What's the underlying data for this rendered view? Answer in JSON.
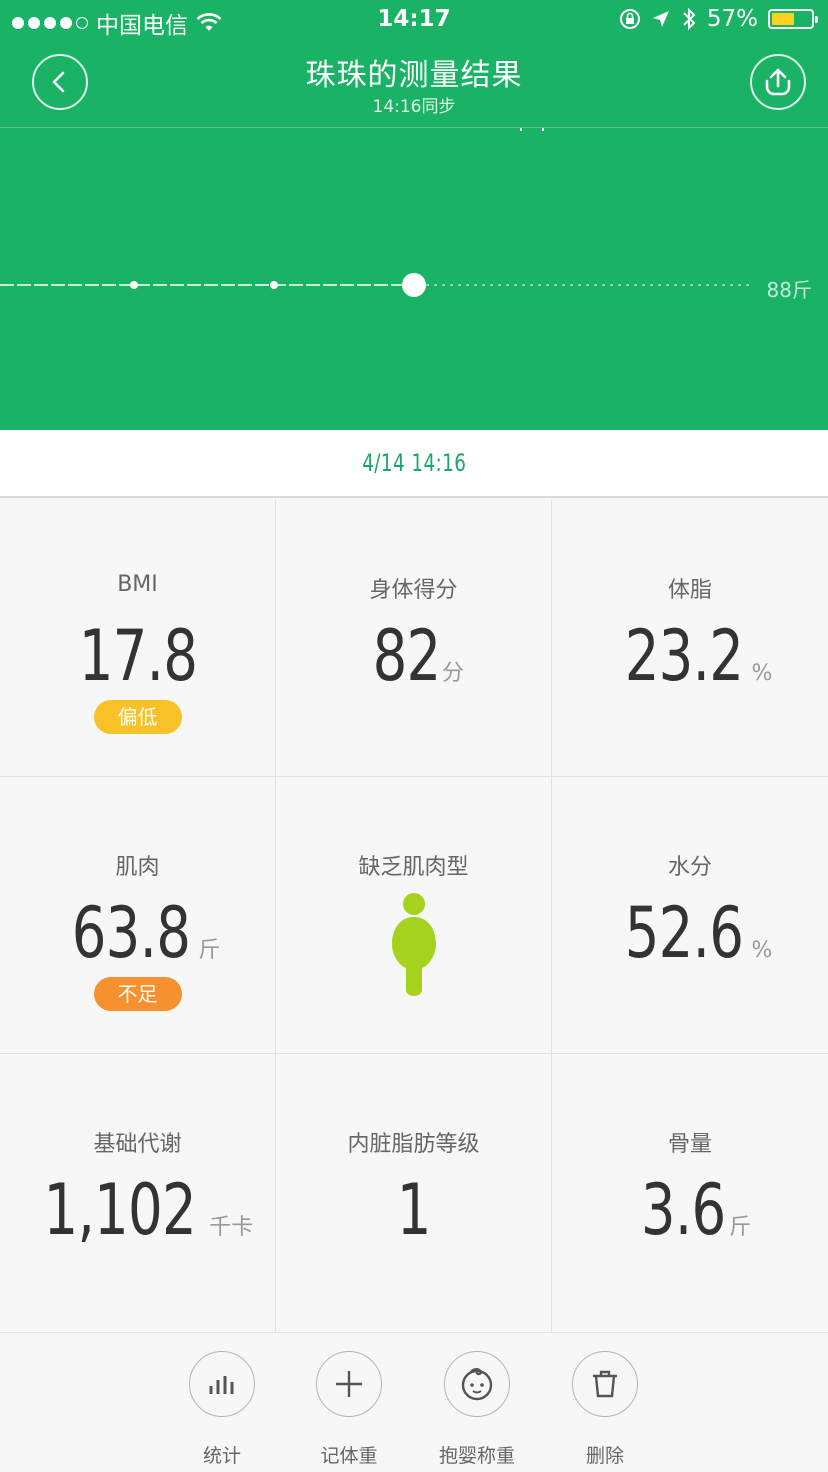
{
  "status_bar": {
    "carrier": "中国电信",
    "time": "14:17",
    "battery_percent": "57%",
    "battery_level": 0.57,
    "icons": [
      "signal-dots-icon",
      "wifi-icon",
      "orientation-lock-icon",
      "location-arrow-icon",
      "bluetooth-icon",
      "battery-icon"
    ]
  },
  "nav": {
    "title": "珠珠的测量结果",
    "subtitle": "14:16同步",
    "back_icon": "chevron-left-icon",
    "share_icon": "upload-icon"
  },
  "chart_data": {
    "type": "line",
    "unit_label": "88斤",
    "points_visible": 4,
    "current_point": "latest"
  },
  "date_bar": {
    "date_time": "4/14 14:16"
  },
  "metrics": [
    {
      "label": "BMI",
      "value": "17.8",
      "unit": "",
      "badge": "偏低",
      "badge_color": "#f8c127"
    },
    {
      "label": "身体得分",
      "value": "82",
      "unit": "分",
      "badge": ""
    },
    {
      "label": "体脂",
      "value": "23.2",
      "unit": "%",
      "badge": ""
    },
    {
      "label": "肌肉",
      "value": "63.8",
      "unit": "斤",
      "badge": "不足",
      "badge_color": "#f7902e"
    },
    {
      "label": "缺乏肌肉型",
      "value": "",
      "unit": "",
      "badge": "",
      "icon": "body-type-figure-icon",
      "icon_color": "#a5d21c"
    },
    {
      "label": "水分",
      "value": "52.6",
      "unit": "%",
      "badge": ""
    },
    {
      "label": "基础代谢",
      "value": "1,102",
      "unit": "千卡",
      "badge": ""
    },
    {
      "label": "内脏脂肪等级",
      "value": "1",
      "unit": "",
      "badge": ""
    },
    {
      "label": "骨量",
      "value": "3.6",
      "unit": "斤",
      "badge": ""
    }
  ],
  "toolbar": {
    "items": [
      {
        "label": "统计",
        "icon": "bar-chart-icon"
      },
      {
        "label": "记体重",
        "icon": "plus-icon"
      },
      {
        "label": "抱婴称重",
        "icon": "baby-face-icon"
      },
      {
        "label": "删除",
        "icon": "trash-icon"
      }
    ]
  },
  "colors": {
    "brand_green": "#1ab366",
    "date_green": "#1aa765",
    "text_dark": "#333333",
    "badge_yellow": "#f8c127",
    "badge_orange": "#f7902e",
    "figure_green": "#a5d21c"
  }
}
